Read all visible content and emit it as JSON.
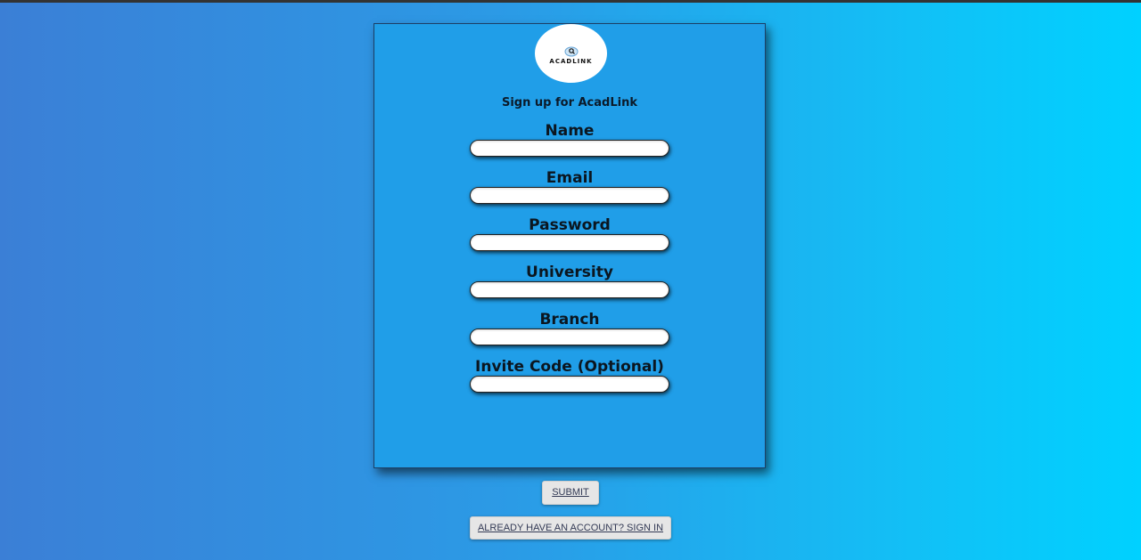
{
  "logo": {
    "text": "ACADLINK"
  },
  "form": {
    "title": "Sign up for AcadLink",
    "fields": [
      {
        "label": "Name",
        "value": "",
        "placeholder": ""
      },
      {
        "label": "Email",
        "value": "",
        "placeholder": ""
      },
      {
        "label": "Password",
        "value": "",
        "placeholder": ""
      },
      {
        "label": "University",
        "value": "",
        "placeholder": ""
      },
      {
        "label": "Branch",
        "value": "",
        "placeholder": ""
      },
      {
        "label": "Invite Code (Optional)",
        "value": "",
        "placeholder": ""
      }
    ]
  },
  "actions": {
    "submit_label": "SUBMIT",
    "signin_label": "ALREADY HAVE AN ACCOUNT? SIGN IN"
  },
  "colors": {
    "card_background": "#209ee8",
    "page_gradient_start": "#3b7fd6",
    "page_gradient_end": "#00d1ff",
    "button_background": "#e6e6e6"
  }
}
